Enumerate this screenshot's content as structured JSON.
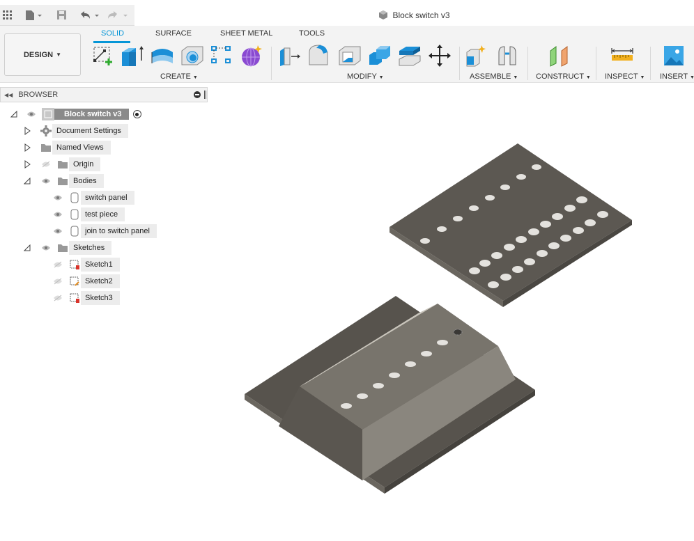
{
  "window": {
    "title": "Block switch v3"
  },
  "workspace": {
    "label": "DESIGN"
  },
  "tabs": [
    {
      "label": "SOLID",
      "active": true
    },
    {
      "label": "SURFACE"
    },
    {
      "label": "SHEET METAL"
    },
    {
      "label": "TOOLS"
    }
  ],
  "groups": {
    "create": "CREATE",
    "modify": "MODIFY",
    "assemble": "ASSEMBLE",
    "construct": "CONSTRUCT",
    "inspect": "INSPECT",
    "insert": "INSERT"
  },
  "browser": {
    "title": "BROWSER",
    "root": "Block switch v3",
    "items": [
      {
        "label": "Document Settings"
      },
      {
        "label": "Named Views"
      },
      {
        "label": "Origin"
      },
      {
        "label": "Bodies"
      },
      {
        "label": "switch panel"
      },
      {
        "label": "test piece"
      },
      {
        "label": "join to switch panel"
      },
      {
        "label": "Sketches"
      },
      {
        "label": "Sketch1"
      },
      {
        "label": "Sketch2"
      },
      {
        "label": "Sketch3"
      }
    ]
  },
  "colors": {
    "accent": "#0696d7",
    "body": "#5a5650"
  }
}
